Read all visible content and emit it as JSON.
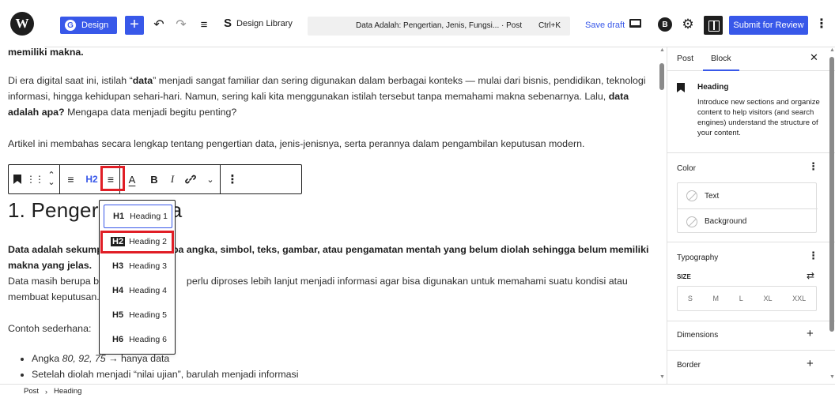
{
  "topbar": {
    "wp_logo": "W",
    "design_button": "Design",
    "design_badge": "G",
    "add_block": "+",
    "design_library": "Design Library",
    "command_title": "Data Adalah: Pengertian, Jenis, Fungsi... · Post",
    "command_shortcut": "Ctrl+K",
    "save_draft": "Save draft",
    "avatar_letter": "B",
    "submit": "Submit for Review",
    "icons": [
      "undo-icon",
      "redo-icon",
      "list-view-icon",
      "device-preview-icon",
      "settings-gear-icon",
      "sidebar-toggle-icon",
      "more-options-icon"
    ]
  },
  "content": {
    "p_top": "memiliki makna.",
    "p1_a": "Di era digital saat ini, istilah “",
    "p1_bold1": "data",
    "p1_b": "” menjadi sangat familiar dan sering digunakan dalam berbagai konteks — mulai dari bisnis, pendidikan, teknologi informasi, hingga kehidupan sehari-hari. Namun, sering kali kita menggunakan istilah tersebut tanpa memahami makna sebenarnya. Lalu, ",
    "p1_bold2": "data adalah apa?",
    "p1_c": " Mengapa data menjadi begitu penting?",
    "p2": "Artikel ini membahas secara lengkap tentang pengertian data, jenis-jenisnya, serta perannya dalam pengambilan keputusan modern.",
    "heading": "1. Pengertian Data",
    "p3_bold_a": "Data adalah sekumpulan fakta berupa angka, ",
    "p3_bold_b": "simbol, teks, gambar, atau pengamatan mentah yang belum diolah sehingga belum memiliki makna yang jelas.",
    "p4_a": "Data masih berupa ba",
    "p4_b": "perlu diproses lebih lanjut menjadi informasi agar bisa digunakan untuk memahami suatu kondisi atau membuat keputusan.",
    "p5": "Contoh sederhana:",
    "bullet1_a": "Angka ",
    "bullet1_em": "80, 92, 75",
    "bullet1_b": " → hanya data",
    "bullet2": "Setelah diolah menjadi “nilai ujian”, barulah menjadi informasi"
  },
  "block_toolbar": {
    "heading_level": "H2",
    "bold": "B",
    "italic": "I",
    "text_color": "A",
    "icons": [
      "bookmark-icon",
      "drag-handle-icon",
      "move-up-down-icon",
      "align-icon",
      "text-align-icon",
      "link-icon",
      "chevron-down-icon",
      "more-vertical-icon"
    ]
  },
  "heading_dropdown": {
    "items": [
      {
        "tag": "H1",
        "label": "Heading 1"
      },
      {
        "tag": "H2",
        "label": "Heading 2"
      },
      {
        "tag": "H3",
        "label": "Heading 3"
      },
      {
        "tag": "H4",
        "label": "Heading 4"
      },
      {
        "tag": "H5",
        "label": "Heading 5"
      },
      {
        "tag": "H6",
        "label": "Heading 6"
      }
    ],
    "selected_index": 1
  },
  "sidebar": {
    "tab_post": "Post",
    "tab_block": "Block",
    "close": "✕",
    "block_title": "Heading",
    "block_desc": "Introduce new sections and organize content to help visitors (and search engines) understand the structure of your content.",
    "color_title": "Color",
    "color_text": "Text",
    "color_background": "Background",
    "typography_title": "Typography",
    "size_label": "SIZE",
    "sizes": [
      "S",
      "M",
      "L",
      "XL",
      "XXL"
    ],
    "dimensions_title": "Dimensions",
    "border_title": "Border"
  },
  "footer": {
    "crumb_post": "Post",
    "crumb_sep": "›",
    "crumb_heading": "Heading"
  },
  "colors": {
    "accent": "#3858e9",
    "highlight": "#e01e26",
    "text": "#1e1e1e"
  }
}
